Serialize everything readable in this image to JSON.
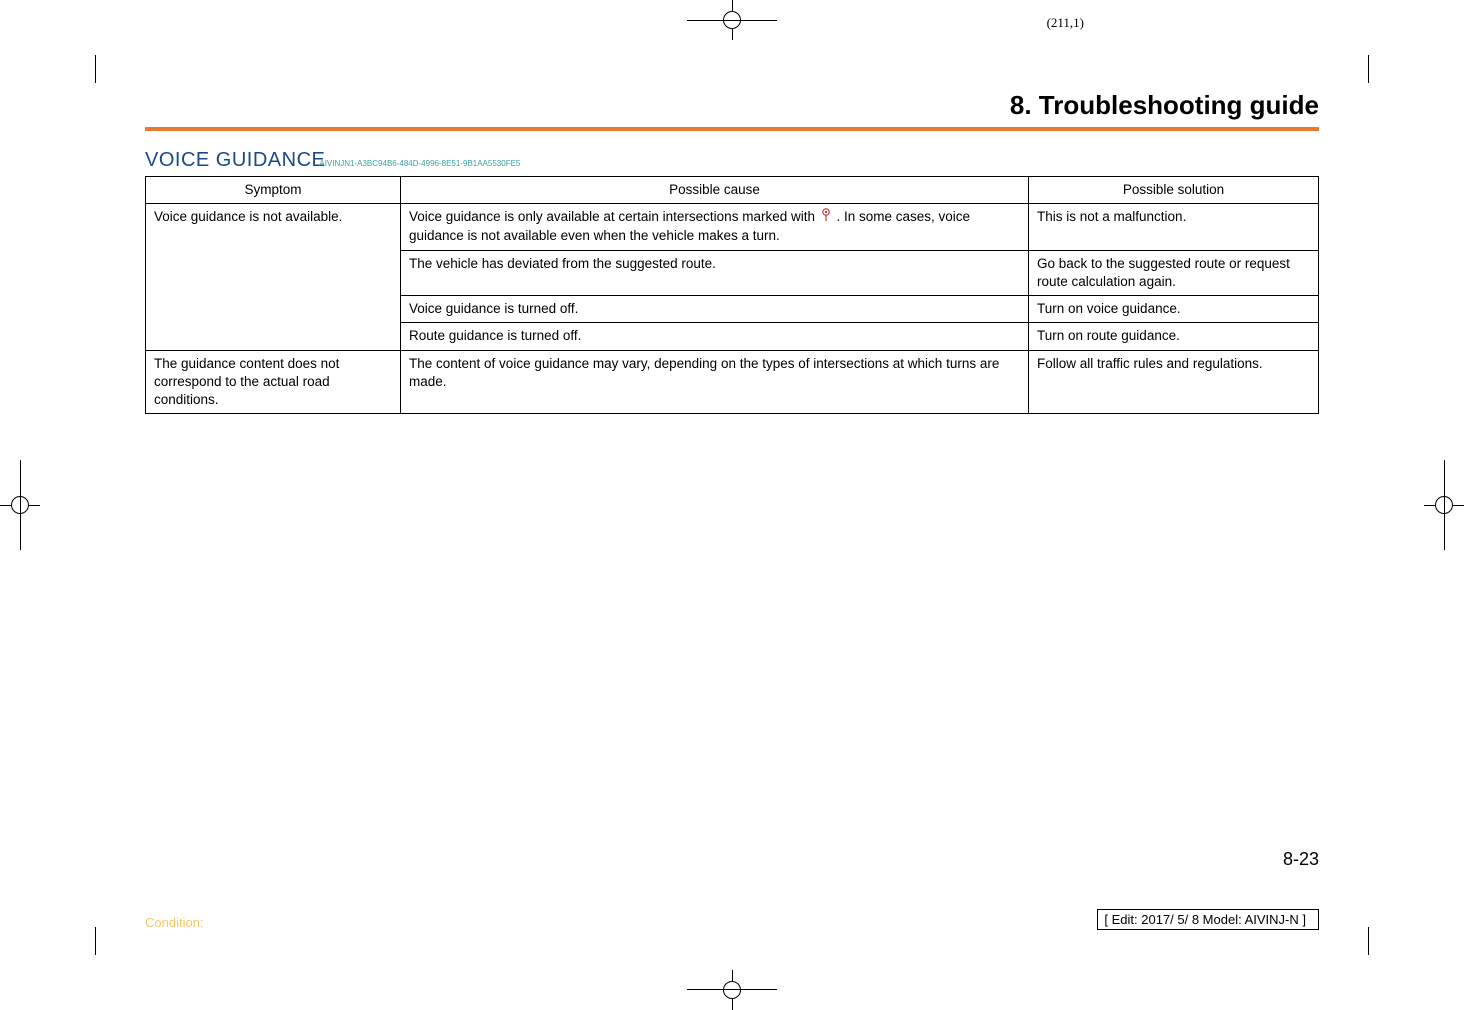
{
  "coord_marker": "(211,1)",
  "header_title": "8. Troubleshooting guide",
  "section_title": "VOICE GUIDANCE",
  "revision_id": "AIVINJN1-A3BC94B6-484D-4996-8E51-9B1AA5530FE5",
  "table": {
    "headers": {
      "symptom": "Symptom",
      "cause": "Possible cause",
      "solution": "Possible solution"
    },
    "rows": [
      {
        "symptom": "Voice guidance is not available.",
        "cause_pre": "Voice guidance is only available at certain intersections marked with ",
        "cause_post": " . In some cases, voice guidance is not available even when the vehicle makes a turn.",
        "solution": "This is not a malfunction."
      },
      {
        "cause": "The vehicle has deviated from the suggested route.",
        "solution": "Go back to the suggested route or request route calculation again."
      },
      {
        "cause": "Voice guidance is turned off.",
        "solution": "Turn on voice guidance."
      },
      {
        "cause": "Route guidance is turned off.",
        "solution": "Turn on route guidance."
      },
      {
        "symptom": "The guidance content does not correspond to the actual road conditions.",
        "cause": "The content of voice guidance may vary, depending on the types of intersections at which turns are made.",
        "solution": "Follow all traffic rules and regulations."
      }
    ]
  },
  "page_number": "8-23",
  "condition_label": "Condition:",
  "edit_info": "[ Edit: 2017/ 5/ 8   Model:  AIVINJ-N ]"
}
